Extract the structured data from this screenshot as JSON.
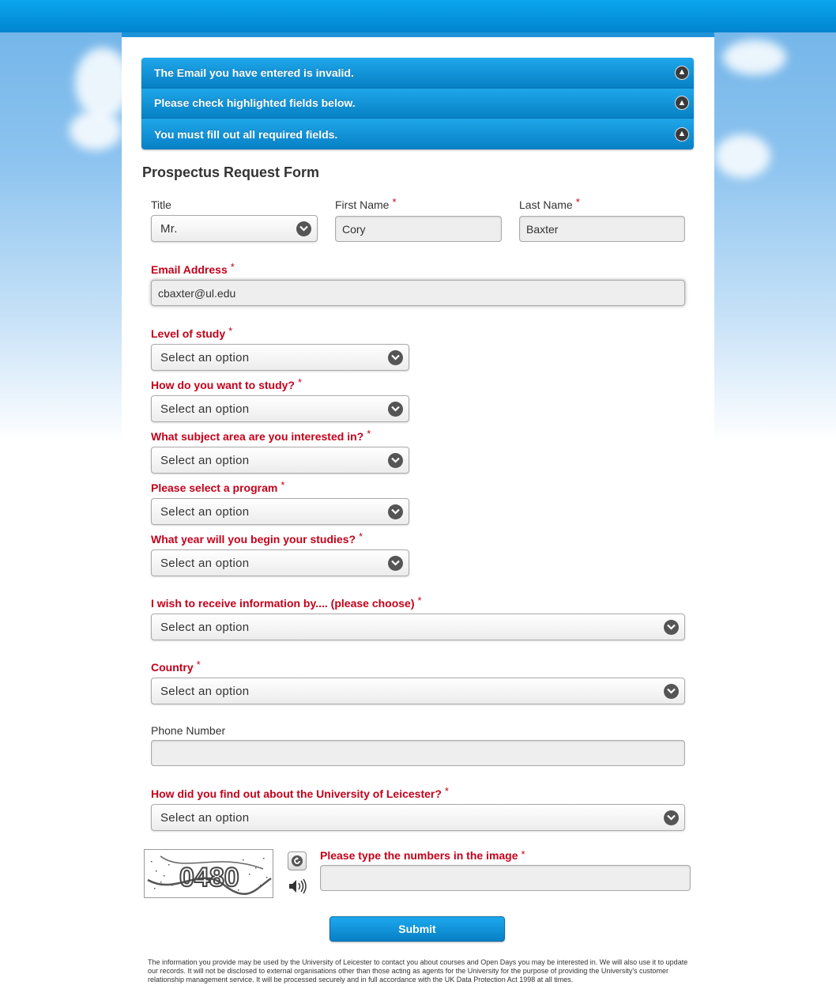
{
  "alerts": [
    "The Email you have entered is invalid.",
    "Please check highlighted fields below.",
    "You must fill out all required fields."
  ],
  "form_title": "Prospectus Request Form",
  "fields": {
    "title": {
      "label": "Title",
      "value": "Mr."
    },
    "first_name": {
      "label": "First Name",
      "value": "Cory"
    },
    "last_name": {
      "label": "Last Name",
      "value": "Baxter"
    },
    "email": {
      "label": "Email Address",
      "value": "cbaxter@ul.edu"
    },
    "level_of_study": {
      "label": "Level of study",
      "value": "Select an option"
    },
    "study_mode": {
      "label": "How do you want to study?",
      "value": "Select an option"
    },
    "subject_area": {
      "label": "What subject area are you interested in?",
      "value": "Select an option"
    },
    "program": {
      "label": "Please select a program",
      "value": "Select an option"
    },
    "start_year": {
      "label": "What year will you begin your studies?",
      "value": "Select an option"
    },
    "info_by": {
      "label": "I wish to receive information by.... (please choose)",
      "value": "Select an option"
    },
    "country": {
      "label": "Country",
      "value": "Select an option"
    },
    "phone": {
      "label": "Phone Number",
      "value": ""
    },
    "how_found": {
      "label": "How did you find out about the University of Leicester?",
      "value": "Select an option"
    },
    "captcha": {
      "label": "Please type the numbers in the image",
      "value": "",
      "image_text": "0480"
    }
  },
  "required_marker": "*",
  "submit_label": "Submit",
  "footer": "The information you provide may be used by the University of Leicester to contact you about courses and Open Days you may be interested in. We will also use it to update our records. It will not be disclosed to external organisations other than those acting as agents for the University for the purpose of providing the University's customer relationship management service. It will be processed securely and in full accordance with the UK Data Protection Act 1998 at all times.",
  "icons": {
    "alert": "warning-icon",
    "dropdown": "chevron-down-icon",
    "refresh": "refresh-icon",
    "audio": "speaker-icon"
  },
  "colors": {
    "accent": "#0a8fd8",
    "required": "#c4001a"
  }
}
